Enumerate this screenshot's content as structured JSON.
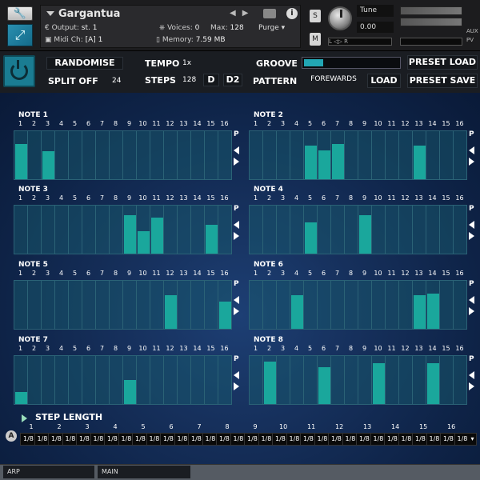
{
  "instrument": {
    "name": "Gargantua",
    "output_label": "Output:",
    "output_value": "st. 1",
    "voices_label": "Voices:",
    "voices_value": "0",
    "max_label": "Max:",
    "max_value": "128",
    "purge_label": "Purge",
    "midi_label": "Midi Ch:",
    "midi_value": "[A]  1",
    "memory_label": "Memory:",
    "memory_value": "7.59 MB",
    "s_label": "S",
    "m_label": "M",
    "tune_label": "Tune",
    "tune_value": "0.00",
    "pan_marker": "L  ◁▷  R",
    "aux_label": "AUX",
    "pv_label": "PV"
  },
  "controls": {
    "randomise": "RANDOMISE",
    "split_off": "SPLIT OFF",
    "split_value": "24",
    "tempo_label": "TEMPO",
    "tempo_value": "1x",
    "steps_label": "STEPS",
    "steps_value": "128",
    "d_button": "D",
    "d2_button": "D2",
    "groove_label": "GROOVE",
    "groove_amount": 0.2,
    "pattern_label": "PATTERN",
    "pattern_value": "FOREWARDS",
    "load": "LOAD",
    "preset_load": "PRESET LOAD",
    "preset_save": "PRESET SAVE"
  },
  "step_numbers": [
    "1",
    "2",
    "3",
    "4",
    "5",
    "6",
    "7",
    "8",
    "9",
    "10",
    "11",
    "12",
    "13",
    "14",
    "15",
    "16"
  ],
  "side_p": "P",
  "notes": [
    {
      "title": "NOTE 1",
      "values": [
        0.75,
        0,
        0.6,
        0,
        0,
        0,
        0,
        0,
        0,
        0,
        0,
        0,
        0,
        0,
        0,
        0
      ]
    },
    {
      "title": "NOTE 2",
      "values": [
        0,
        0,
        0,
        0,
        0.72,
        0.62,
        0.75,
        0,
        0,
        0,
        0,
        0,
        0.72,
        0,
        0,
        0
      ]
    },
    {
      "title": "NOTE 3",
      "values": [
        0,
        0,
        0,
        0,
        0,
        0,
        0,
        0,
        0.82,
        0.48,
        0.78,
        0,
        0,
        0,
        0.62,
        0
      ]
    },
    {
      "title": "NOTE 4",
      "values": [
        0,
        0,
        0,
        0,
        0.68,
        0,
        0,
        0,
        0.82,
        0,
        0,
        0,
        0,
        0,
        0,
        0
      ]
    },
    {
      "title": "NOTE 5",
      "values": [
        0,
        0,
        0,
        0,
        0,
        0,
        0,
        0,
        0,
        0,
        0,
        0.73,
        0,
        0,
        0,
        0.58
      ]
    },
    {
      "title": "NOTE 6",
      "values": [
        0,
        0,
        0,
        0.72,
        0,
        0,
        0,
        0,
        0,
        0,
        0,
        0,
        0.73,
        0.75,
        0,
        0
      ]
    },
    {
      "title": "NOTE 7",
      "values": [
        0.25,
        0,
        0,
        0,
        0,
        0,
        0,
        0,
        0.52,
        0,
        0,
        0,
        0,
        0,
        0,
        0
      ]
    },
    {
      "title": "NOTE 8",
      "values": [
        0,
        0.92,
        0,
        0,
        0,
        0.8,
        0,
        0,
        0,
        0.88,
        0,
        0,
        0,
        0.88,
        0,
        0
      ]
    }
  ],
  "step_length": {
    "title": "STEP LENGTH",
    "a_icon": "A",
    "numbers": [
      "1",
      "2",
      "3",
      "4",
      "5",
      "6",
      "7",
      "8",
      "9",
      "10",
      "11",
      "12",
      "13",
      "14",
      "15",
      "16"
    ],
    "values": [
      "1/8",
      "1/8",
      "1/8",
      "1/8",
      "1/8",
      "1/8",
      "1/8",
      "1/8",
      "1/8",
      "1/8",
      "1/8",
      "1/8",
      "1/8",
      "1/8",
      "1/8",
      "1/8",
      "1/8",
      "1/8",
      "1/8",
      "1/8",
      "1/8",
      "1/8",
      "1/8",
      "1/8",
      "1/8",
      "1/8",
      "1/8",
      "1/8",
      "1/8",
      "1/8",
      "1/8",
      "1/8"
    ]
  },
  "footer": {
    "tab_arp": "ARP",
    "tab_main": "MAIN"
  },
  "colors": {
    "bar": "#1aa79c",
    "accent": "#22a6b4"
  }
}
